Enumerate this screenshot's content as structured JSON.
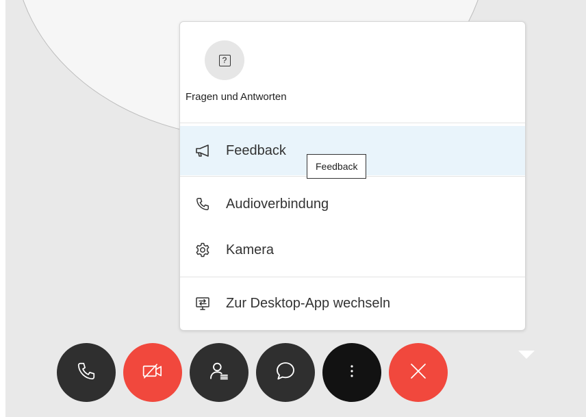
{
  "menu": {
    "qa_tile": {
      "label": "Fragen und Antworten",
      "icon": "question-box-icon",
      "icon_glyph": "?"
    },
    "items": [
      {
        "label": "Feedback",
        "icon": "megaphone-icon",
        "active": true
      },
      {
        "label": "Audioverbindung",
        "icon": "phone-icon",
        "active": false
      },
      {
        "label": "Kamera",
        "icon": "gear-icon",
        "active": false
      },
      {
        "label": "Zur Desktop-App wechseln",
        "icon": "desktop-switch-icon",
        "active": false
      }
    ]
  },
  "tooltip": {
    "text": "Feedback"
  },
  "call_controls": [
    {
      "name": "audio-button",
      "icon": "phone-icon",
      "color": "#2f2f2f"
    },
    {
      "name": "video-button",
      "icon": "video-off-icon",
      "color": "#f1483d"
    },
    {
      "name": "participants-button",
      "icon": "participants-icon",
      "color": "#2f2f2f"
    },
    {
      "name": "chat-button",
      "icon": "chat-bubble-icon",
      "color": "#2f2f2f"
    },
    {
      "name": "more-options-button",
      "icon": "more-vertical-icon",
      "color": "#121212"
    },
    {
      "name": "leave-button",
      "icon": "close-icon",
      "color": "#f1483d"
    }
  ],
  "colors": {
    "active_row": "#e9f4fb",
    "danger": "#f1483d",
    "dark_button": "#2f2f2f",
    "background": "#e9e9e9"
  }
}
